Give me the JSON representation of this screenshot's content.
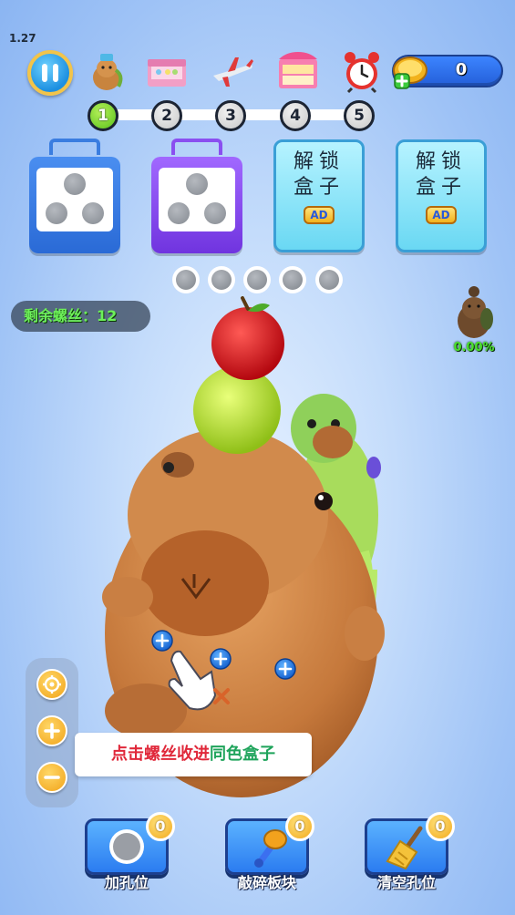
{
  "hud": {
    "version": "1.27",
    "coins": "0",
    "level_icons": [
      "capybara-icon",
      "gift-box-icon",
      "airplane-icon",
      "shop-stall-icon",
      "alarm-clock-icon"
    ]
  },
  "progress": {
    "steps": [
      "1",
      "2",
      "3",
      "4",
      "5"
    ],
    "current_step": 1
  },
  "boxes": {
    "unlock_label_1": "解锁",
    "unlock_label_2": "盒子",
    "ad_label": "AD"
  },
  "status": {
    "remaining_screws": "剩余螺丝：12",
    "completion": "0.00%"
  },
  "tip": {
    "part1": "点击螺丝收进",
    "part2": "同色盒子"
  },
  "tools": [
    {
      "label": "加孔位",
      "count": "0"
    },
    {
      "label": "敲碎板块",
      "count": "0"
    },
    {
      "label": "清空孔位",
      "count": "0"
    }
  ],
  "colors": {
    "screw_blue": "#1f7be8",
    "tip_red": "#e0283a",
    "tip_green": "#1fa45b",
    "progress_active": "#59c21a"
  }
}
